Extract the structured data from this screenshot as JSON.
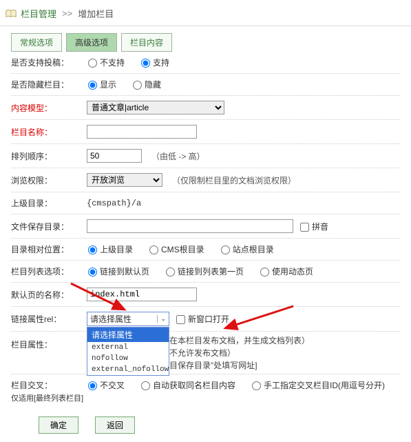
{
  "breadcrumb": {
    "root": "栏目管理",
    "sep": ">>",
    "current": "增加栏目"
  },
  "tabs": {
    "t0": "常规选项",
    "t1": "高级选项",
    "t2": "栏目内容"
  },
  "labels": {
    "allow_submit": "是否支持投稿：",
    "hide_col": "是否隐藏栏目：",
    "content_model": "内容模型：",
    "col_name": "栏目名称：",
    "sort": "排列顺序：",
    "browse_perm": "浏览权限：",
    "parent": "上级目录：",
    "save_dir": "文件保存目录：",
    "dir_relative": "目录相对位置：",
    "list_opt": "栏目列表选项：",
    "default_page": "默认页的名称：",
    "rel_attr": "链接属性rel：",
    "col_attr": "栏目属性：",
    "cross": "栏目交叉：",
    "cross_note": "仅适用[最终列表栏目]"
  },
  "radios": {
    "no_support": "不支持",
    "support": "支持",
    "show": "显示",
    "hide": "隐藏",
    "parent_dir": "上级目录",
    "cms_root": "CMS根目录",
    "site_root": "站点根目录",
    "link_default": "链接到默认页",
    "link_first": "链接到列表第一页",
    "use_dynamic": "使用动态页",
    "no_cross": "不交叉",
    "auto_cross": "自动获取同名栏目内容",
    "manual_cross": "手工指定交叉栏目ID(用逗号分开)"
  },
  "fields": {
    "content_model_sel": "普通文章|article",
    "sort_value": "50",
    "sort_hint": "（由低 -> 高）",
    "browse_sel": "开放浏览",
    "browse_hint": "（仅限制栏目里的文档浏览权限）",
    "parent_value": "{cmspath}/a",
    "pinyin": "拼音",
    "default_page_value": "index.html",
    "rel_placeholder": "请选择属性",
    "new_window": "新窗口打开"
  },
  "rel_options": {
    "o0": "请选择属性",
    "o1": "external",
    "o2": "nofollow",
    "o3": "external_nofollow"
  },
  "col_attr_lines": {
    "l0": "在本栏目发布文档，并生成文档列表）",
    "l1": "不允许发布文档）",
    "l2": "目保存目录\"处填写网址]"
  },
  "buttons": {
    "ok": "确定",
    "back": "返回"
  }
}
